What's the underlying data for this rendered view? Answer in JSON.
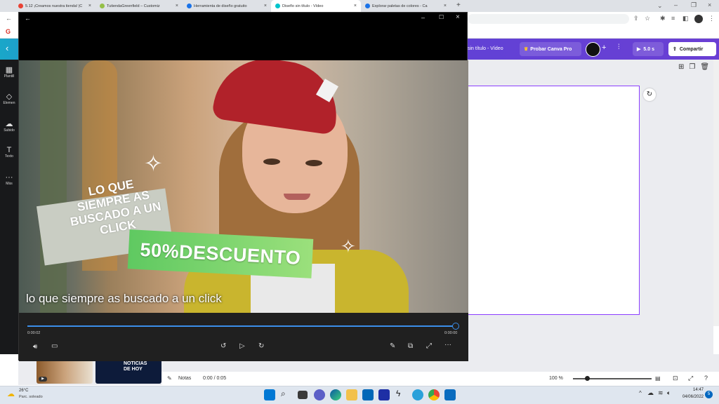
{
  "browser": {
    "tabs": [
      {
        "label": "5.12 ¡Creamos nuestra tienda! |C",
        "color": "#e94235"
      },
      {
        "label": "TutiendaGreenfield – Customiz",
        "color": "#95bf47"
      },
      {
        "label": "Herramienta de diseño gratuito",
        "color": "#1a73e8"
      },
      {
        "label": "Diseño sin título - Vídeo",
        "color": "#00c4cc"
      },
      {
        "label": "Explorar paletas de colores - Ca",
        "color": "#1a73e8"
      }
    ],
    "new_tab": "+",
    "bookmark_gmail": "G"
  },
  "canva": {
    "title": "sin título - Vídeo",
    "try_pro": "Probar Canva Pro",
    "duration": "5.0 s",
    "share": "Compartir",
    "sidebar": [
      {
        "label": "Plantill"
      },
      {
        "label": "Elemen"
      },
      {
        "label": "Subido"
      },
      {
        "label": "Texto"
      },
      {
        "label": "Más"
      }
    ],
    "notes_label": "Notas",
    "time_display": "0:00 / 0:05",
    "zoom": "100 %",
    "thumb2_text_1": "NOTICIAS",
    "thumb2_text_2": "DE HOY"
  },
  "video": {
    "overlay_line1": "LO QUE",
    "overlay_line2": "SIEMPRE AS",
    "overlay_line3": "BUSCADO A UN",
    "overlay_line4": "CLICK",
    "discount": "50%DESCUENTO",
    "subtitle": "lo que siempre as buscado a un click",
    "time_current": "0:00:02",
    "time_remaining": "0:00:00",
    "progress": 1.0
  },
  "taskbar": {
    "temperature": "26°C",
    "weather": "Parc. soleado",
    "time": "14:47",
    "date": "04/06/2022",
    "notification_count": "5"
  }
}
